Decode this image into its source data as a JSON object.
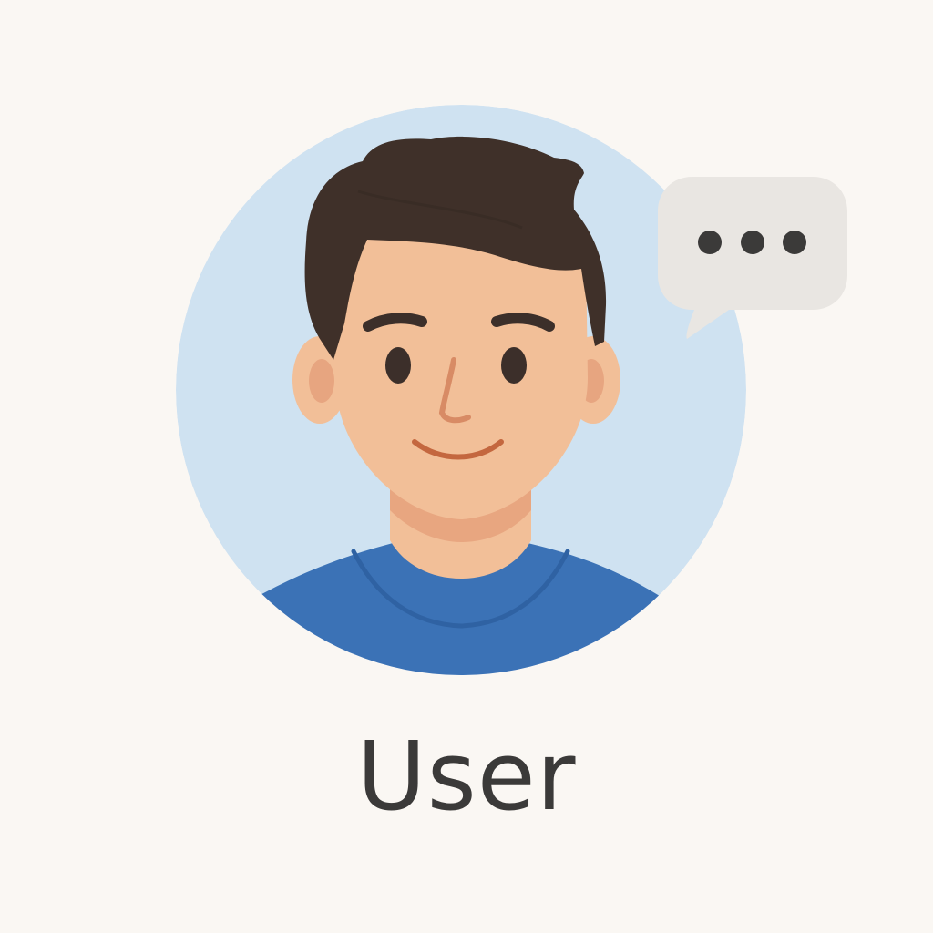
{
  "label": "User",
  "colors": {
    "background": "#faf7f3",
    "avatar_circle": "#cfe2f1",
    "hair": "#3f3029",
    "skin": "#f2bf98",
    "skin_shadow": "#e8a680",
    "ear_inner": "#e7a580",
    "nose": "#d88b65",
    "mouth": "#c4673f",
    "eyes": "#3c2f2a",
    "shirt": "#3b72b6",
    "shirt_collar": "#2f62a3",
    "bubble": "#e9e6e2",
    "bubble_dots": "#3b3a39",
    "label_text": "#3b3a39"
  },
  "icons": {
    "avatar": "user-avatar-icon",
    "chat": "speech-bubble-typing-icon"
  }
}
